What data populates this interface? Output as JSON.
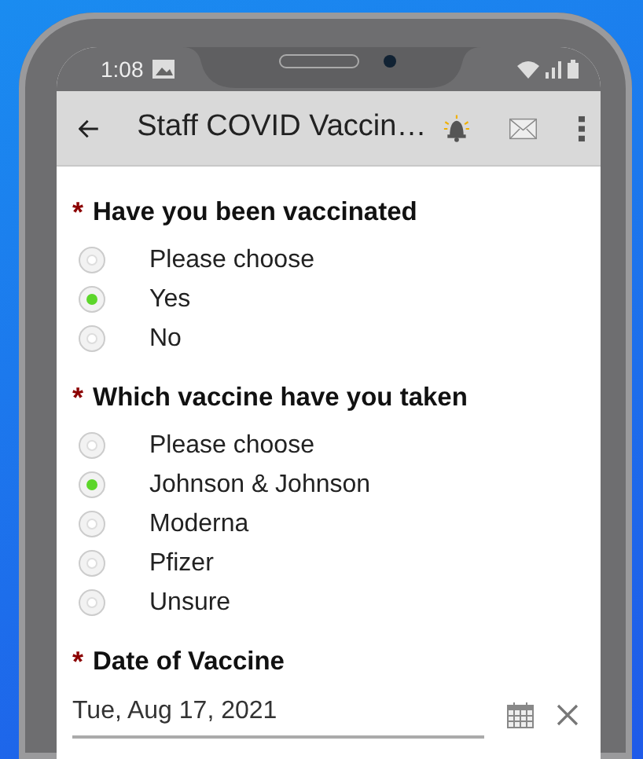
{
  "status_bar": {
    "time": "1:08"
  },
  "app_bar": {
    "title": "Staff COVID Vaccin…"
  },
  "questions": [
    {
      "kind": "radio",
      "required_mark": "*",
      "label": "Have you been vaccinated",
      "options": [
        {
          "label": "Please choose",
          "selected": false
        },
        {
          "label": "Yes",
          "selected": true
        },
        {
          "label": "No",
          "selected": false
        }
      ]
    },
    {
      "kind": "radio",
      "required_mark": "*",
      "label": "Which vaccine have you taken",
      "options": [
        {
          "label": "Please choose",
          "selected": false
        },
        {
          "label": "Johnson & Johnson",
          "selected": true
        },
        {
          "label": "Moderna",
          "selected": false
        },
        {
          "label": "Pfizer",
          "selected": false
        },
        {
          "label": "Unsure",
          "selected": false
        }
      ]
    },
    {
      "kind": "date",
      "required_mark": "*",
      "label": "Date of Vaccine",
      "value": "Tue, Aug 17, 2021"
    }
  ]
}
